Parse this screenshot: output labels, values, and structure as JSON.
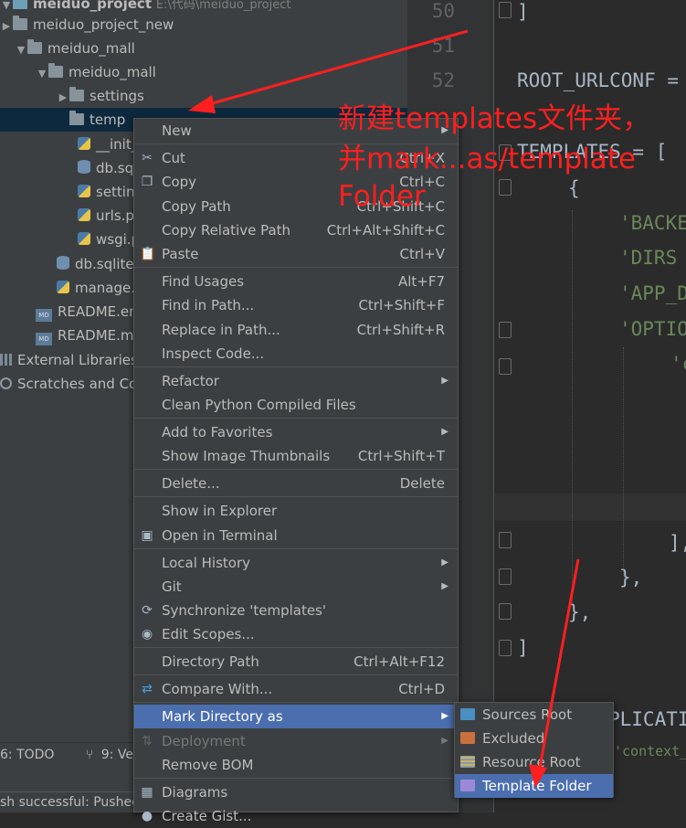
{
  "project_tree": {
    "root_label": "meiduo_project",
    "root_path": "E:\\代码\\meiduo_project",
    "items": [
      {
        "label": "meiduo_project_new",
        "icon": "folder-icon"
      },
      {
        "label": "meiduo_mall",
        "icon": "folder-icon"
      },
      {
        "label": "meiduo_mall",
        "icon": "folder-icon"
      },
      {
        "label": "settings",
        "icon": "folder-icon"
      },
      {
        "label": "temp",
        "icon": "folder-icon"
      },
      {
        "label": "__init_",
        "icon": "python-file-icon"
      },
      {
        "label": "db.sq",
        "icon": "database-icon"
      },
      {
        "label": "settin",
        "icon": "python-file-icon"
      },
      {
        "label": "urls.p",
        "icon": "python-file-icon"
      },
      {
        "label": "wsgi.p",
        "icon": "python-file-icon"
      },
      {
        "label": "db.sqlite",
        "icon": "database-icon"
      },
      {
        "label": "manage.",
        "icon": "python-file-icon"
      },
      {
        "label": "README.en",
        "icon": "markdown-icon"
      },
      {
        "label": "README.mc",
        "icon": "markdown-icon"
      },
      {
        "label": "External Libraries",
        "icon": "library-icon"
      },
      {
        "label": "Scratches and Cor",
        "icon": "scratches-icon"
      }
    ]
  },
  "bottom_tools": {
    "todo": "6: TODO",
    "vcs": "9: Ver"
  },
  "status_bar": {
    "text": "sh successful: Pushec"
  },
  "editor": {
    "line_numbers": [
      "50",
      "51",
      "52"
    ],
    "lines": {
      "l50": "]",
      "l52": "ROOT_URLCONF =",
      "l53": "TEMPLATES = [",
      "l54": "{",
      "l55": "'BACKE",
      "l56": "'DIRS",
      "l57": "'APP_D",
      "l58": "'OPTIO",
      "l59": "'c",
      "l61": "],",
      "l62": "},",
      "l63": "},",
      "l64": "]",
      "l66": "PLICATI",
      "l67": "'context_pr"
    }
  },
  "context_menu": {
    "new": "New",
    "cut": "Cut",
    "cut_sc": "Ctrl+X",
    "copy": "Copy",
    "copy_sc": "Ctrl+C",
    "copy_path": "Copy Path",
    "copy_path_sc": "Ctrl+Shift+C",
    "copy_rel": "Copy Relative Path",
    "copy_rel_sc": "Ctrl+Alt+Shift+C",
    "paste": "Paste",
    "paste_sc": "Ctrl+V",
    "find_usages": "Find Usages",
    "find_usages_sc": "Alt+F7",
    "find_in_path": "Find in Path...",
    "find_in_path_sc": "Ctrl+Shift+F",
    "replace_in_path": "Replace in Path...",
    "replace_in_path_sc": "Ctrl+Shift+R",
    "inspect": "Inspect Code...",
    "refactor": "Refactor",
    "clean_py": "Clean Python Compiled Files",
    "add_fav": "Add to Favorites",
    "show_thumbs": "Show Image Thumbnails",
    "show_thumbs_sc": "Ctrl+Shift+T",
    "delete": "Delete...",
    "delete_sc": "Delete",
    "show_explorer": "Show in Explorer",
    "open_terminal": "Open in Terminal",
    "local_history": "Local History",
    "git": "Git",
    "sync": "Synchronize 'templates'",
    "edit_scopes": "Edit Scopes...",
    "dir_path": "Directory Path",
    "dir_path_sc": "Ctrl+Alt+F12",
    "compare": "Compare With...",
    "compare_sc": "Ctrl+D",
    "mark_dir": "Mark Directory as",
    "deployment": "Deployment",
    "remove_bom": "Remove BOM",
    "diagrams": "Diagrams",
    "create_gist": "Create Gist..."
  },
  "submenu": {
    "sources_root": "Sources Root",
    "excluded": "Excluded",
    "resource_root": "Resource Root",
    "template_folder": "Template Folder"
  },
  "annotation": {
    "line1": "新建templates文件夹，",
    "line2": "并mark...as/template",
    "line3": "Folder"
  },
  "colors": {
    "accent": "#4b6eaf",
    "annotation": "#ff1f1f",
    "panel": "#3c3f41",
    "editor_bg": "#2b2b2b"
  }
}
